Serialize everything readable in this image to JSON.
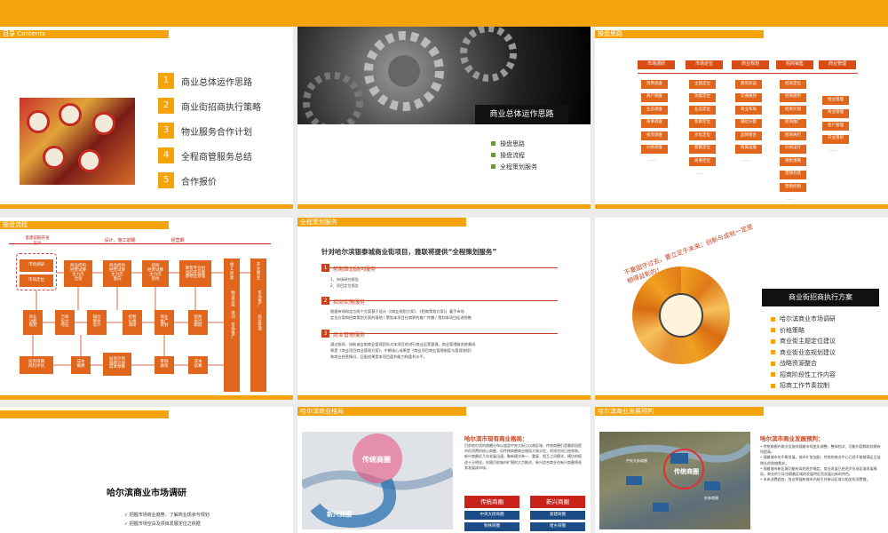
{
  "colors": {
    "accent": "#f5a30a",
    "dark": "#111111",
    "orange_box": "#e0661b",
    "red": "#c9421f"
  },
  "slide1": {
    "header": "目录 Contents",
    "items": [
      {
        "num": "1",
        "label": "商业总体运作思路"
      },
      {
        "num": "2",
        "label": "商业街招商执行策略"
      },
      {
        "num": "3",
        "label": "物业服务合作计划"
      },
      {
        "num": "4",
        "label": "全程商管服务总结"
      },
      {
        "num": "5",
        "label": "合作报价"
      }
    ]
  },
  "slide2": {
    "title": "商业总体运作思路",
    "bullets": [
      "操盘思路",
      "操盘流程",
      "全程策划服务"
    ]
  },
  "slide3": {
    "header": "操盘思路",
    "columns": [
      {
        "head": "市场调研",
        "items": [
          "消费调查",
          "商户调查",
          "业态调查",
          "商事调查",
          "投资调查",
          "价格调查"
        ]
      },
      {
        "head": "市场定位",
        "items": [
          "主题定位",
          "功能定位",
          "业态定位",
          "客群定位",
          "文化定位",
          "客群定位",
          "商事定位"
        ]
      },
      {
        "head": "商业规划",
        "items": [
          "建筑形态",
          "交通规划",
          "商业布局",
          "铺位分割",
          "品牌组合",
          "附属设施"
        ]
      },
      {
        "head": "招商销售",
        "items": [
          "招商定位",
          "招商组织",
          "招商计划",
          "招商推广",
          "招商执行",
          "价格设计",
          "销售策略",
          "营销包装",
          "营销控制"
        ]
      },
      {
        "head": "商业管理",
        "items": [
          "物业管理",
          "商业管理",
          "客户管理",
          "开业策划"
        ]
      }
    ],
    "ellipsis": "……"
  },
  "slide4": {
    "header": "操盘流程",
    "phases": [
      "策建前期开发\n设计",
      "设计、施工前期",
      "经营期"
    ],
    "boxes": {
      "b1": "市场调研",
      "b2": "市场定位",
      "b3": "商品结构\n经营试算\n主力店\n洽谈",
      "b4": "商品结构\n经营试算\n主力店\n意向",
      "b5": "招商\n经营试算\n主力店\n签约",
      "b6": "筹客专业招\n团的开业筹\n备物业管理",
      "b7": "商业\n功能\n规划",
      "b8": "万商\n设计\n经征",
      "b9": "铺位\n整体\n设计",
      "b10": "招租\n价格\n调研",
      "b11": "商业\n推广\n策划",
      "b12": "招商\n执行\n跟踪",
      "b13": "投资周期\n风险评估",
      "b14": "成本\n概算",
      "b15": "投资计划\n施建计划\n成本预算",
      "b16": "筹融\n融资",
      "b17": "成本\n核算",
      "v1": "竣\n工\n验\n收",
      "v1b": "物业交接　培训　市场推广",
      "v2": "开\n业\n营\n业",
      "v2b": "市场推广　　商业管理"
    }
  },
  "slide5": {
    "header": "全程策划服务",
    "title": "针对哈尔滨银泰城商业街项目，雅联将提供“全程策划服务”",
    "sections": [
      {
        "num": "1",
        "title": "前期策划顾问服务",
        "lines": [
          "1、市场研究报告",
          "2、项目定位报告"
        ]
      },
      {
        "num": "2",
        "title": "招商实施服务",
        "lines": [
          "根据市场和定位两个方案基于设计（《商业规划方案》、《招商策划方案》）着手市场",
          "定位方案和招商策划方案的落地 / 策划本项目在商界的推广传播 / 策划本项目促进销售"
        ]
      },
      {
        "num": "3",
        "title": "商业管理服务",
        "lines": [
          "通过指导、协助或会助商业管理团队对本项目的进行商业运营管理。商业管理服务依赖成",
          "果是《商业项目商业管理方案》，中期核心成果是《商业项目商业管理制度与管理流程》",
          "和商业经营情况，匹配成果是本项目盈利能力和盈利水平。"
        ]
      }
    ]
  },
  "slide6": {
    "ring_text": "不要固守过去，要立足于未来；创新与成就一定是相得益彰的！",
    "title": "商业街招商执行方案",
    "items": [
      "哈尔滨商业市场调研",
      "价格策略",
      "商业街主题定位建议",
      "商业街业态规划建议",
      "战略资源整合",
      "招商阶段性工作内容",
      "招商工作节奏控制"
    ]
  },
  "slide7": {
    "title": "哈尔滨商业市场调研",
    "items": [
      "✓ 把握市场商业趋势、了解商业现状与规划",
      "✓ 把握市场空白及项目发展定位之依据"
    ]
  },
  "slide8": {
    "header": "哈尔滨商业格局",
    "heading": "哈尔滨市现有商业格局：",
    "text": "目前哈尔滨的商圈分布以道里中央大街江以南区域、传统商圈仍是最前段提市民消费的核心商圈，但传统商圈商业格局大致分定，利润空间已经饱和。新兴商圈近几年发展迅速，聚新模式单一、重复、相互之间模式、模仿的痕迹十分明显，伴随目前城市扩围的大力推进，新兴综合商业在新兴商圈将逐渐发展成市场。",
    "map_labels": [
      "传统商圈",
      "新兴商圈"
    ],
    "zones": [
      {
        "head": "传统商圈",
        "items": [
          "中央大街商圈",
          "秋林商圈",
          "南岗商圈"
        ]
      },
      {
        "head": "新兴商圈",
        "items": [
          "爱建商圈",
          "哈乡商圈",
          "学府商圈"
        ]
      }
    ]
  },
  "slide9": {
    "header": "哈尔滨商业发展预判",
    "heading": "哈尔滨市商业发展预判：",
    "text": "• 传统商圈内商业设施伴随着市场变化调整，整体档次、功能内容都较前期有所提高。\n• 随着城市的不断发展，城市扩张加剧，传统的商业中心已经不能够满足日益增长的购物需求。\n• 随着城市新区城功能布局的逐步确定，商业发展已经逐步形成区域发展格局，商业的引导也随着区域的发展特征而发展出新的特色。\n• 未来消费趋势，势必将辐射城市内核引并带动区域与相关的消费需。",
    "map_labels": [
      "传统商圈",
      "中央大街商圈",
      "秋林商圈"
    ]
  }
}
